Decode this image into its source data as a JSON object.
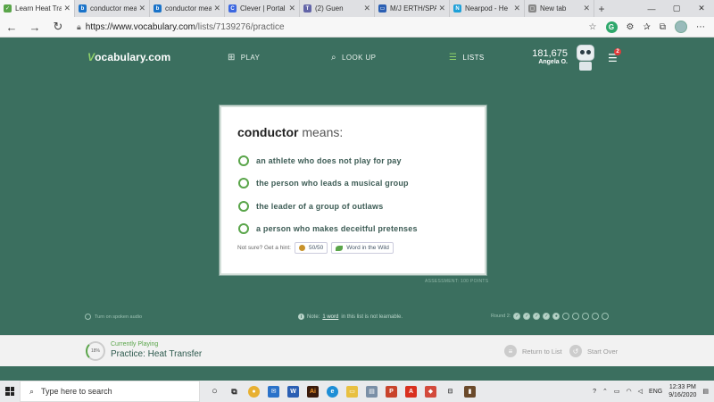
{
  "browser": {
    "tabs": [
      {
        "title": "Learn Heat Tra",
        "icon": "vocab-check-icon",
        "color": "#5aa54a",
        "active": true
      },
      {
        "title": "conductor mea",
        "icon": "bing-icon",
        "color": "#1a73c9"
      },
      {
        "title": "conductor mea",
        "icon": "bing-icon",
        "color": "#1a73c9"
      },
      {
        "title": "Clever | Portal",
        "icon": "clever-icon",
        "color": "#3d68e0"
      },
      {
        "title": "(2) Guen",
        "icon": "teams-icon",
        "color": "#6264a7"
      },
      {
        "title": "M/J ERTH/SPAC",
        "icon": "classroom-icon",
        "color": "#2b5fb3"
      },
      {
        "title": "Nearpod - He",
        "icon": "nearpod-icon",
        "color": "#1ea0d8"
      },
      {
        "title": "New tab",
        "icon": "newtab-icon",
        "color": "#888"
      }
    ],
    "url_host": "https://www.vocabulary.com",
    "url_path": "/lists/7139276/practice"
  },
  "site": {
    "logo_v": "V",
    "logo_rest": "ocabulary.com",
    "nav": {
      "play": "PLAY",
      "lookup": "LOOK UP",
      "lists": "LISTS"
    },
    "points": "181,675",
    "user": "Angela O.",
    "badge_count": "2"
  },
  "question": {
    "word": "conductor",
    "means": " means:",
    "options": [
      "an athlete who does not play for pay",
      "the person who leads a musical group",
      "the leader of a group of outlaws",
      "a person who makes deceitful pretenses"
    ],
    "hint_label": "Not sure? Get a hint:",
    "hint_5050": "50/50",
    "hint_wild": "Word in the Wild"
  },
  "assessment": "ASSESSMENT: 100 POINTS",
  "footer": {
    "spoken_audio": "Turn on spoken audio",
    "note_prefix": "Note: ",
    "note_link": "1 word",
    "note_suffix": " in this list is not learnable.",
    "round_label": "Round 2:"
  },
  "bottom": {
    "progress": "18%",
    "currently_playing": "Currently Playing",
    "practice_name": "Practice: Heat Transfer",
    "return_to_list": "Return to List",
    "start_over": "Start Over"
  },
  "taskbar": {
    "search_placeholder": "Type here to search",
    "lang": "ENG",
    "time": "12:33 PM",
    "date": "9/16/2020"
  }
}
